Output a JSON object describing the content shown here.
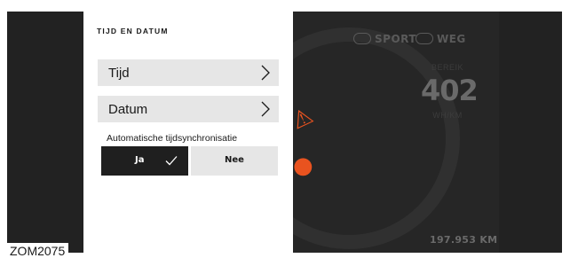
{
  "settings": {
    "title": "TIJD EN DATUM",
    "rows": [
      {
        "label": "Tijd"
      },
      {
        "label": "Datum"
      }
    ],
    "sync": {
      "label": "Automatische tijdsynchronisatie",
      "yes_label": "Ja",
      "no_label": "Nee",
      "selected": "Ja"
    }
  },
  "cluster": {
    "modes": [
      "SPORT",
      "WEG"
    ],
    "distance_label": "BEREIK",
    "distance_value": "402",
    "distance_unit": "WH/KM",
    "odometer": "197.953 KM"
  },
  "figure_code": "ZOM2075",
  "colors": {
    "accent_orange": "#e9531f",
    "selected_button": "#1f1f1f",
    "row_background": "#e6e6e6",
    "screen_background": "#1d1d1d"
  },
  "icons": [
    "chevron-right-icon",
    "checkmark-icon"
  ]
}
